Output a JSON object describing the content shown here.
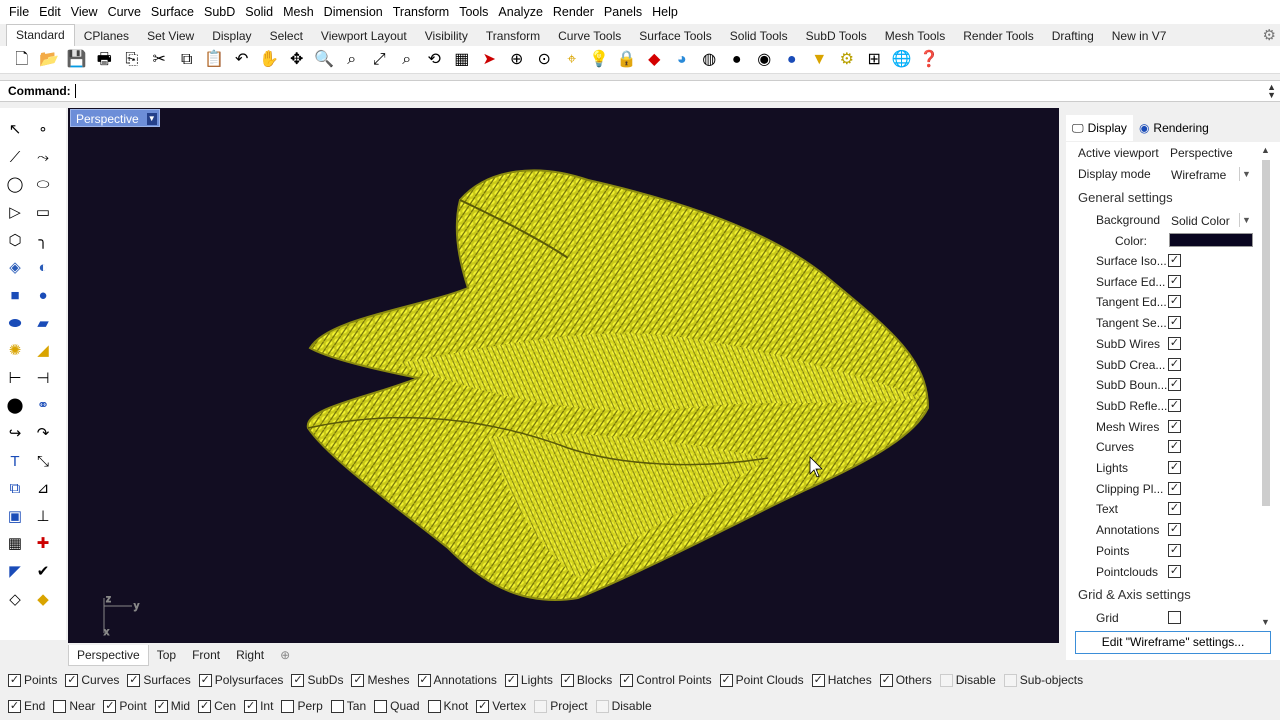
{
  "menu": [
    "File",
    "Edit",
    "View",
    "Curve",
    "Surface",
    "SubD",
    "Solid",
    "Mesh",
    "Dimension",
    "Transform",
    "Tools",
    "Analyze",
    "Render",
    "Panels",
    "Help"
  ],
  "tabs": [
    "Standard",
    "CPlanes",
    "Set View",
    "Display",
    "Select",
    "Viewport Layout",
    "Visibility",
    "Transform",
    "Curve Tools",
    "Surface Tools",
    "Solid Tools",
    "SubD Tools",
    "Mesh Tools",
    "Render Tools",
    "Drafting",
    "New in V7"
  ],
  "active_tab": "Standard",
  "command": {
    "label": "Command:",
    "value": ""
  },
  "viewport": {
    "title": "Perspective",
    "background": "#120d22",
    "mesh_color": "#d8d820",
    "axis_labels": {
      "z": "z",
      "y": "y",
      "x": "x"
    }
  },
  "view_tabs": [
    "Perspective",
    "Top",
    "Front",
    "Right"
  ],
  "active_view_tab": "Perspective",
  "panel": {
    "tabs": [
      {
        "label": "Display",
        "icon": "monitor-icon"
      },
      {
        "label": "Rendering",
        "icon": "teapot-icon"
      }
    ],
    "active_viewport_label": "Active viewport",
    "active_viewport_value": "Perspective",
    "display_mode_label": "Display mode",
    "display_mode_value": "Wireframe",
    "general_settings": "General settings",
    "background_label": "Background",
    "background_value": "Solid Color",
    "color_label": "Color:",
    "color_value": "#0a0620",
    "checkboxes": [
      {
        "label": "Surface Iso...",
        "checked": true
      },
      {
        "label": "Surface Ed...",
        "checked": true
      },
      {
        "label": "Tangent Ed...",
        "checked": true
      },
      {
        "label": "Tangent Se...",
        "checked": true
      },
      {
        "label": "SubD Wires",
        "checked": true
      },
      {
        "label": "SubD Crea...",
        "checked": true
      },
      {
        "label": "SubD Boun...",
        "checked": true
      },
      {
        "label": "SubD Refle...",
        "checked": true
      },
      {
        "label": "Mesh Wires",
        "checked": true
      },
      {
        "label": "Curves",
        "checked": true
      },
      {
        "label": "Lights",
        "checked": true
      },
      {
        "label": "Clipping Pl...",
        "checked": true
      },
      {
        "label": "Text",
        "checked": true
      },
      {
        "label": "Annotations",
        "checked": true
      },
      {
        "label": "Points",
        "checked": true
      },
      {
        "label": "Pointclouds",
        "checked": true
      }
    ],
    "grid_axis_settings": "Grid & Axis settings",
    "grid_label": "Grid",
    "grid_checked": false,
    "edit_button": "Edit \"Wireframe\" settings..."
  },
  "select_filter": [
    {
      "label": "Points",
      "checked": true
    },
    {
      "label": "Curves",
      "checked": true
    },
    {
      "label": "Surfaces",
      "checked": true
    },
    {
      "label": "Polysurfaces",
      "checked": true
    },
    {
      "label": "SubDs",
      "checked": true
    },
    {
      "label": "Meshes",
      "checked": true
    },
    {
      "label": "Annotations",
      "checked": true
    },
    {
      "label": "Lights",
      "checked": true
    },
    {
      "label": "Blocks",
      "checked": true
    },
    {
      "label": "Control Points",
      "checked": true
    },
    {
      "label": "Point Clouds",
      "checked": true
    },
    {
      "label": "Hatches",
      "checked": true
    },
    {
      "label": "Others",
      "checked": true
    },
    {
      "label": "Disable",
      "checked": false,
      "disabled": true
    },
    {
      "label": "Sub-objects",
      "checked": false,
      "disabled": true
    }
  ],
  "osnaps": [
    {
      "label": "End",
      "checked": true
    },
    {
      "label": "Near",
      "checked": false
    },
    {
      "label": "Point",
      "checked": true
    },
    {
      "label": "Mid",
      "checked": true
    },
    {
      "label": "Cen",
      "checked": true
    },
    {
      "label": "Int",
      "checked": true
    },
    {
      "label": "Perp",
      "checked": false
    },
    {
      "label": "Tan",
      "checked": false
    },
    {
      "label": "Quad",
      "checked": false
    },
    {
      "label": "Knot",
      "checked": false
    },
    {
      "label": "Vertex",
      "checked": true
    },
    {
      "label": "Project",
      "checked": false,
      "disabled": true
    },
    {
      "label": "Disable",
      "checked": false,
      "disabled": true
    }
  ]
}
